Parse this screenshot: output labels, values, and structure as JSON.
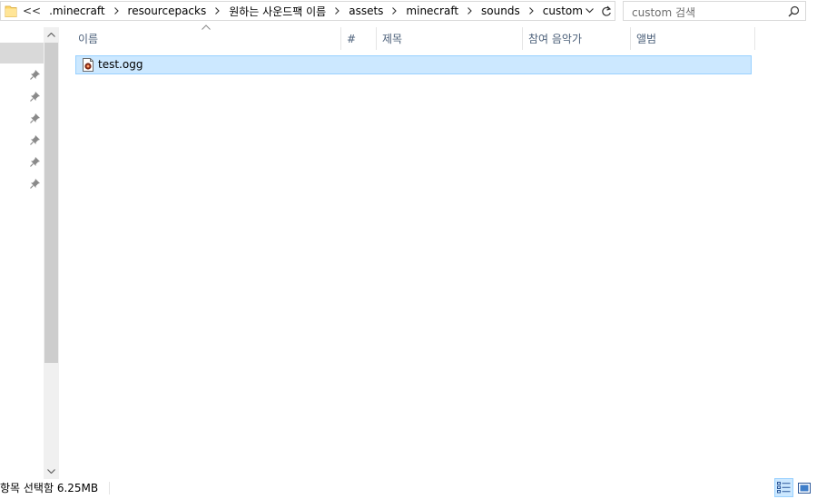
{
  "address_bar": {
    "overflow": "<<",
    "crumbs": [
      ".minecraft",
      "resourcepacks",
      "원하는 사운드팩 이름",
      "assets",
      "minecraft",
      "sounds",
      "custom"
    ]
  },
  "search": {
    "placeholder": "custom 검색"
  },
  "columns": {
    "name": "이름",
    "track": "#",
    "title": "제목",
    "artist": "참여 음악가",
    "album": "앨범"
  },
  "files": [
    {
      "name": "test.ogg",
      "selected": true
    }
  ],
  "status_bar": {
    "text": "항목 선택함 6.25MB"
  },
  "colors": {
    "selection_fill": "#cce8ff",
    "selection_border": "#99d1ff",
    "header_text": "#4c607a",
    "folder_yellow": "#ffd867"
  },
  "icons": {
    "folder": "folder-icon",
    "search": "search-icon",
    "refresh": "refresh-icon",
    "dropdown": "chevron-down-icon",
    "pin": "pin-icon",
    "file": "audio-file-icon",
    "details_view": "details-view-icon",
    "large_icons_view": "large-icons-view-icon"
  }
}
